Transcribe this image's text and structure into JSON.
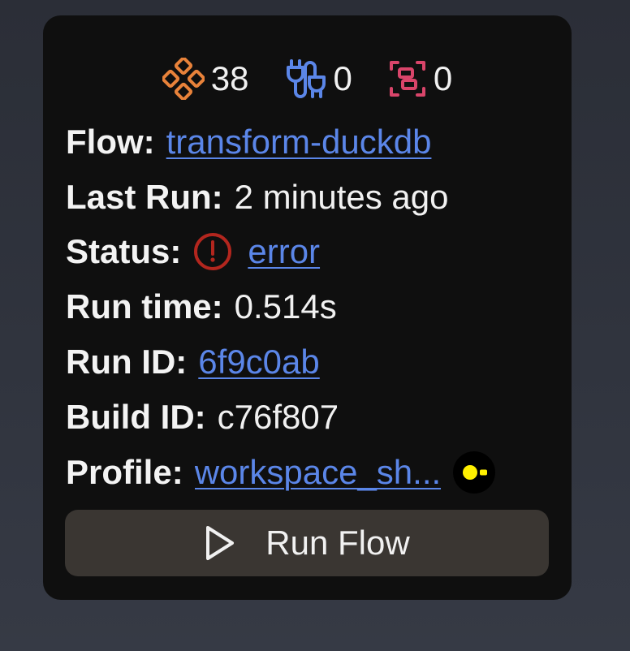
{
  "counters": {
    "models": "38",
    "sources": "0",
    "tests": "0"
  },
  "icons": {
    "models": "model-nodes-icon",
    "sources": "plug-icon",
    "tests": "brackets-icon",
    "status": "alert-circle-icon",
    "profile": "duckdb-icon",
    "run": "play-icon"
  },
  "colors": {
    "models_icon": "#e8823a",
    "sources_icon": "#5b86e8",
    "tests_icon": "#d9456a",
    "error": "#b3261e",
    "link": "#5b86e8",
    "duckdb_icon": "#fff000"
  },
  "details": {
    "flow_label": "Flow:",
    "flow_value": "transform-duckdb",
    "last_run_label": "Last Run:",
    "last_run_value": "2 minutes ago",
    "status_label": "Status:",
    "status_value": "error",
    "run_time_label": "Run time:",
    "run_time_value": "0.514s",
    "run_id_label": "Run ID:",
    "run_id_value": "6f9c0ab",
    "build_id_label": "Build ID:",
    "build_id_value": "c76f807",
    "profile_label": "Profile:",
    "profile_value": "workspace_sh..."
  },
  "actions": {
    "run_flow_label": "Run Flow"
  }
}
